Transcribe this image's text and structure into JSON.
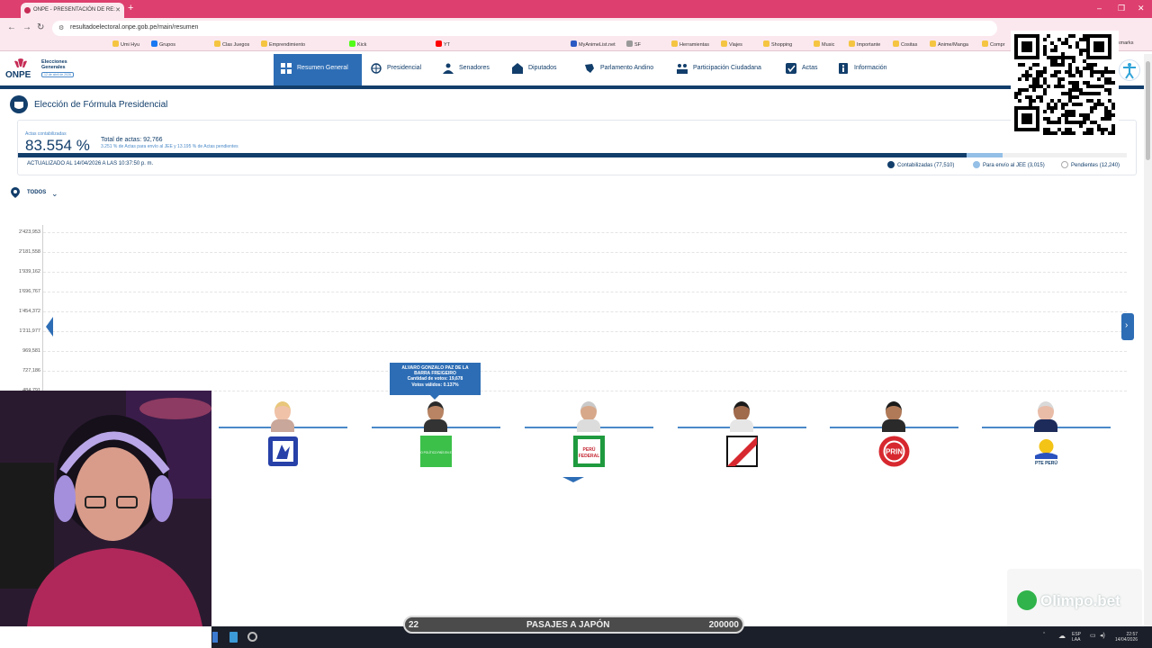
{
  "browser": {
    "tab_title": "ONPE - PRESENTACIÓN DE RE:",
    "url": "resultadoelectoral.onpe.gob.pe/main/resumen",
    "bookmarks": [
      "Umi Hyu",
      "Grupos",
      "Clas Juegos",
      "Emprendimiento",
      "Kick",
      "YT",
      "MyAnimeList.net",
      "SF",
      "Herramientas",
      "Viajes",
      "Shopping",
      "Music",
      "Importante",
      "Cositas",
      "Anime/Manga",
      "Compr"
    ],
    "all_bookmarks": "Bookmarks"
  },
  "site": {
    "logo": "ONPE",
    "logo_sub_1": "Elecciones",
    "logo_sub_2": "Generales",
    "logo_date": "12 de abril de 2026",
    "nav": [
      {
        "label": "Resumen General",
        "icon": "grid-icon"
      },
      {
        "label": "Presidencial",
        "icon": "globe-icon"
      },
      {
        "label": "Senadores",
        "icon": "people-icon"
      },
      {
        "label": "Diputados",
        "icon": "building-icon"
      },
      {
        "label": "Parlamento Andino",
        "icon": "map-icon"
      },
      {
        "label": "Participación Ciudadana",
        "icon": "group-icon"
      },
      {
        "label": "Actas",
        "icon": "checkbox-icon"
      },
      {
        "label": "Información",
        "icon": "info-icon"
      }
    ]
  },
  "page": {
    "title": "Elección de Fórmula Presidencial"
  },
  "summary": {
    "actas_label": "Actas contabilizadas",
    "actas_pct": "83.554 %",
    "actas_fraction": 0.83554,
    "jee_fraction": 0.03251,
    "total": "Total de actas: 92,766",
    "subnote": "3.251 % de Actas para envío al JEE y 13.195 % de Actas pendientes",
    "updated": "ACTUALIZADO AL 14/04/2026 A LAS 10:37:50 p. m.",
    "legend": [
      {
        "label": "Contabilizadas (77,510)",
        "color": "#123e6b"
      },
      {
        "label": "Para envío al JEE (3,015)",
        "color": "#94bfe6"
      },
      {
        "label": "Pendientes (12,240)",
        "color": "#ffffff"
      }
    ]
  },
  "filter": {
    "label": "TODOS"
  },
  "chart_data": {
    "type": "bar",
    "ylim": [
      0,
      2423953
    ],
    "yticks": [
      "2'423,953",
      "2'181,558",
      "1'939,162",
      "1'696,767",
      "1'454,372",
      "1'211,977",
      "969,581",
      "727,186",
      "484,791"
    ],
    "categories": [
      "",
      "ALVARO GONZALO PAZ DE LA BARRA FREIGEIRO",
      "",
      "",
      "",
      ""
    ],
    "values": [
      0,
      19678,
      0,
      0,
      0,
      0
    ],
    "tooltip": {
      "name": "ALVARO GONZALO PAZ DE LA BARRA FREIGEIRO",
      "votes": "Cantidad de votos: 19,678",
      "valid": "Votos válidos: 0.137%"
    },
    "party_labels": [
      "",
      "PARTIDO POLÍTICO PAÍS EN EL PERÚ",
      "PERÚ FEDERAL",
      "",
      "PRIN",
      "PTE PERÚ"
    ]
  },
  "overlays": {
    "olimpo": "Olimpo.bet",
    "promo_left": "22",
    "promo_center": "PASAJES A JAPÓN",
    "promo_right": "200000",
    "tray_lang": "ESP",
    "tray_kbd": "LAA",
    "tray_time": "22:57",
    "tray_date": "14/04/2026"
  }
}
